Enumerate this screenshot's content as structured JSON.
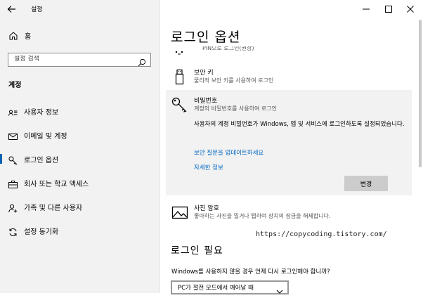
{
  "window": {
    "title": "설정",
    "controls": {
      "minimize": "–",
      "maximize": "☐",
      "close": "✕"
    }
  },
  "sidebar": {
    "home_label": "홈",
    "search_placeholder": "설정 검색",
    "section_title": "계정",
    "items": [
      {
        "label": "사용자 정보",
        "icon": "user-info-icon"
      },
      {
        "label": "이메일 및 계정",
        "icon": "mail-icon"
      },
      {
        "label": "로그인 옵션",
        "icon": "key-icon",
        "selected": true
      },
      {
        "label": "회사 또는 학교 액세스",
        "icon": "briefcase-icon"
      },
      {
        "label": "가족 및 다른 사용자",
        "icon": "add-user-icon"
      },
      {
        "label": "설정 동기화",
        "icon": "sync-icon"
      }
    ]
  },
  "main": {
    "title": "로그인 옵션",
    "pin_partial": "PIN으로 로그인(권장)",
    "security_key": {
      "title": "보안 키",
      "desc": "물리적 보안 키를 사용하여 로그인"
    },
    "password": {
      "title": "비밀번호",
      "desc": "계정의 비밀번호를 사용하여 로그인",
      "info": "사용자의 계정 비밀번호가 Windows, 앱 및 서비스에 로그인하도록 설정되었습니다.",
      "link_update": "보안 질문을 업데이트하세요",
      "link_more": "자세한 정보",
      "change_button": "변경"
    },
    "picture_password": {
      "title": "사진 암호",
      "desc": "좋아하는 사진을 밀거나 탭하여 장치의 잠금을 해제합니다."
    },
    "watermark": "https://copycoding.tistory.com/",
    "require_signin": {
      "title": "로그인 필요",
      "question": "Windows를 사용하지 않을 경우 언제 다시 로그인해야 합니까?",
      "selected_option": "PC가 절전 모드에서 깨어날 때"
    }
  },
  "colors": {
    "accent": "#0063b1",
    "link": "#0067c0",
    "sidebar_bg": "#f2f2f2",
    "panel_bg": "#f2f2f2"
  }
}
